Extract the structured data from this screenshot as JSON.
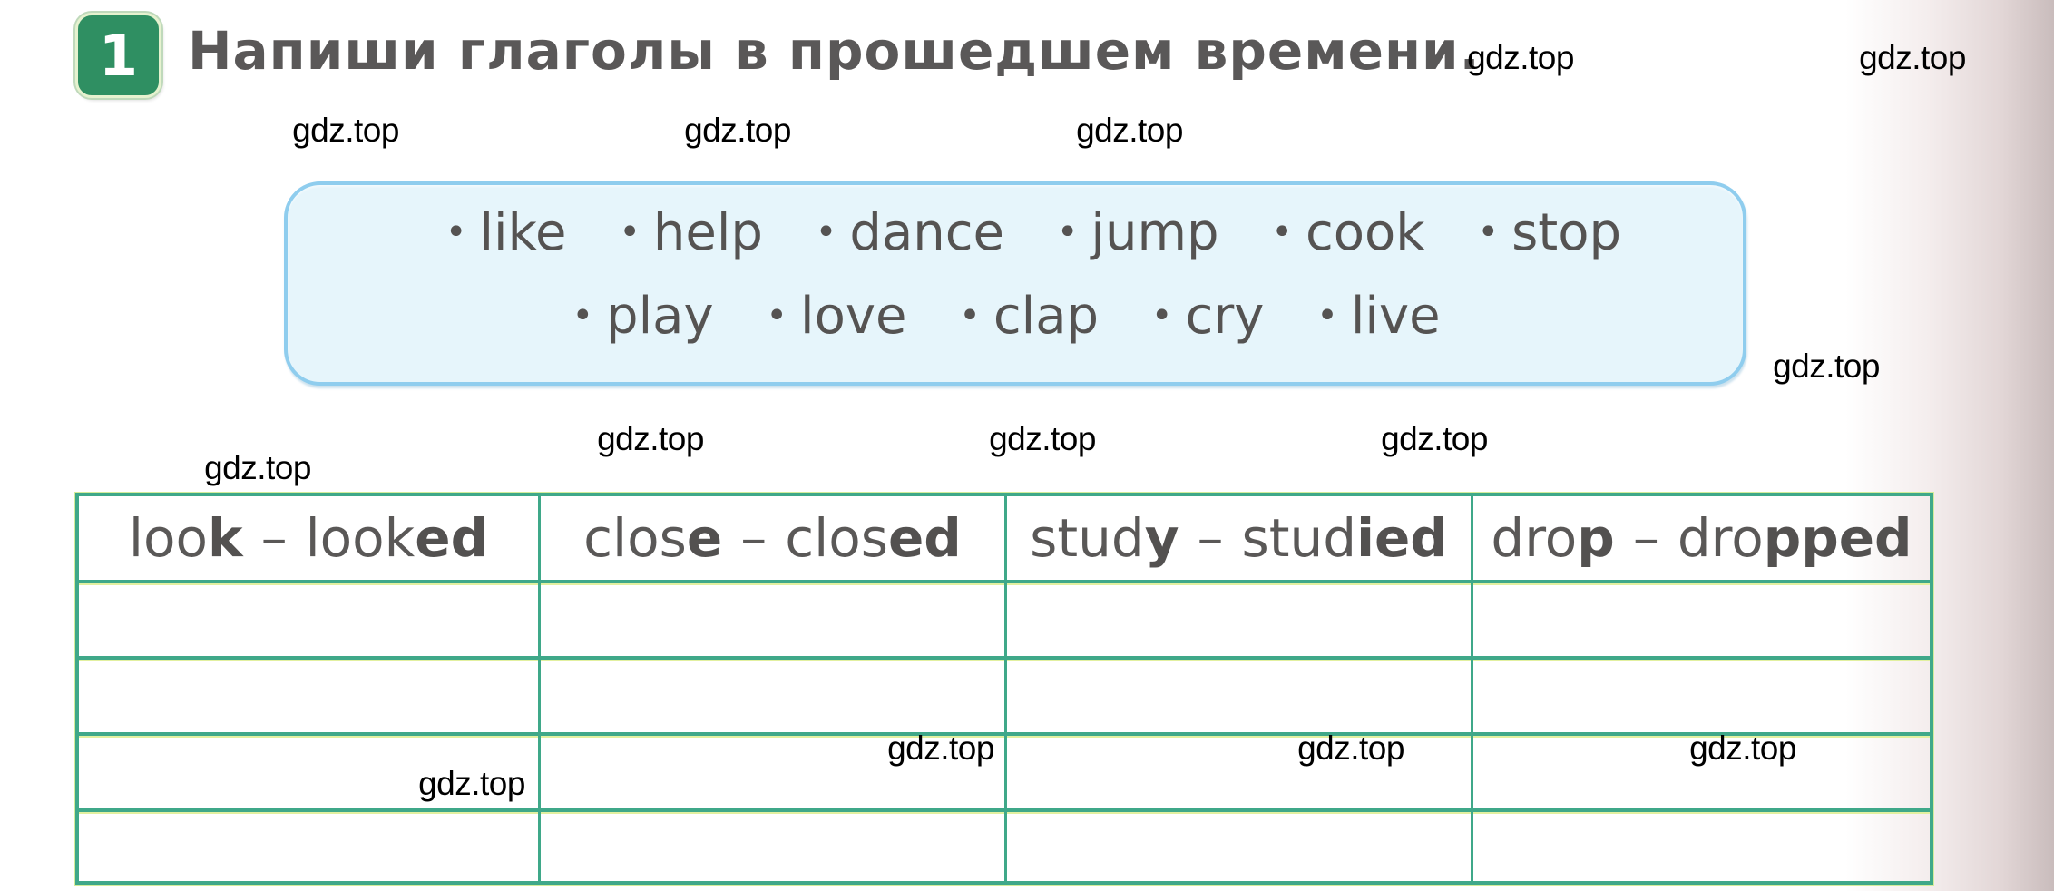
{
  "exercise": {
    "number": "1",
    "title": "Напиши глаголы в прошедшем времени."
  },
  "word_box": {
    "row1": [
      "like",
      "help",
      "dance",
      "jump",
      "cook",
      "stop"
    ],
    "row2": [
      "play",
      "love",
      "clap",
      "cry",
      "live"
    ],
    "bullet": "•"
  },
  "table": {
    "separator": "–",
    "headers": [
      {
        "base_plain": "loo",
        "base_bold": "k",
        "past_plain": "look",
        "past_bold": "ed"
      },
      {
        "base_plain": "clos",
        "base_bold": "e",
        "past_plain": "clos",
        "past_bold": "ed"
      },
      {
        "base_plain": "stud",
        "base_bold": "y",
        "past_plain": "stud",
        "past_bold": "ied"
      },
      {
        "base_plain": "dro",
        "base_bold": "p",
        "past_plain": "dro",
        "past_bold": "pped"
      }
    ],
    "empty_rows": 4
  },
  "watermark": "gdz.top",
  "colors": {
    "badge": "#2f8f62",
    "table_border": "#3fa889",
    "word_box_fill": "#e6f5fb",
    "word_box_border": "#8fcdee",
    "text": "#5a5858"
  }
}
